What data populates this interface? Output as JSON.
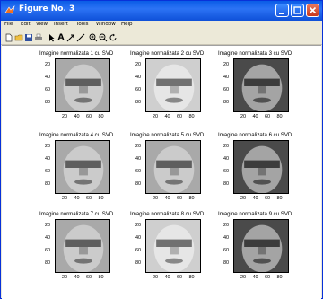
{
  "window": {
    "title": "Figure No. 3"
  },
  "menubar": {
    "items": [
      "File",
      "Edit",
      "View",
      "Insert",
      "Tools",
      "Window",
      "Help"
    ]
  },
  "toolbar": {
    "icons": [
      "new-file-icon",
      "open-folder-icon",
      "save-icon",
      "print-icon",
      "pointer-icon",
      "text-A-icon",
      "arrow-icon",
      "line-icon",
      "zoom-in-icon",
      "zoom-out-icon",
      "rotate-icon"
    ],
    "text_tool_label": "A"
  },
  "panels": [
    {
      "title": "Imagine normalizata 1 cu SVD",
      "tone": "medium"
    },
    {
      "title": "Imagine normalizata 2 cu SVD",
      "tone": "light"
    },
    {
      "title": "Imagine normalizata 3 cu SVD",
      "tone": "dark"
    },
    {
      "title": "Imagine normalizata 4 cu SVD",
      "tone": "medium"
    },
    {
      "title": "Imagine normalizata 5 cu SVD",
      "tone": "medium"
    },
    {
      "title": "Imagine normalizata 6 cu SVD",
      "tone": "dark"
    },
    {
      "title": "Imagine normalizata 7 cu SVD",
      "tone": "medium"
    },
    {
      "title": "Imagine normalizata 8 cu SVD",
      "tone": "light"
    },
    {
      "title": "Imagine normalizata 9 cu SVD",
      "tone": "dark"
    }
  ],
  "axes": {
    "y_ticks": [
      "20",
      "40",
      "60",
      "80"
    ],
    "x_ticks": [
      "20",
      "40",
      "60",
      "80"
    ]
  },
  "colors": {
    "titlebar": "#0a5ce6",
    "window_bg": "#ece9d8",
    "figure_bg": "#ffffff"
  }
}
